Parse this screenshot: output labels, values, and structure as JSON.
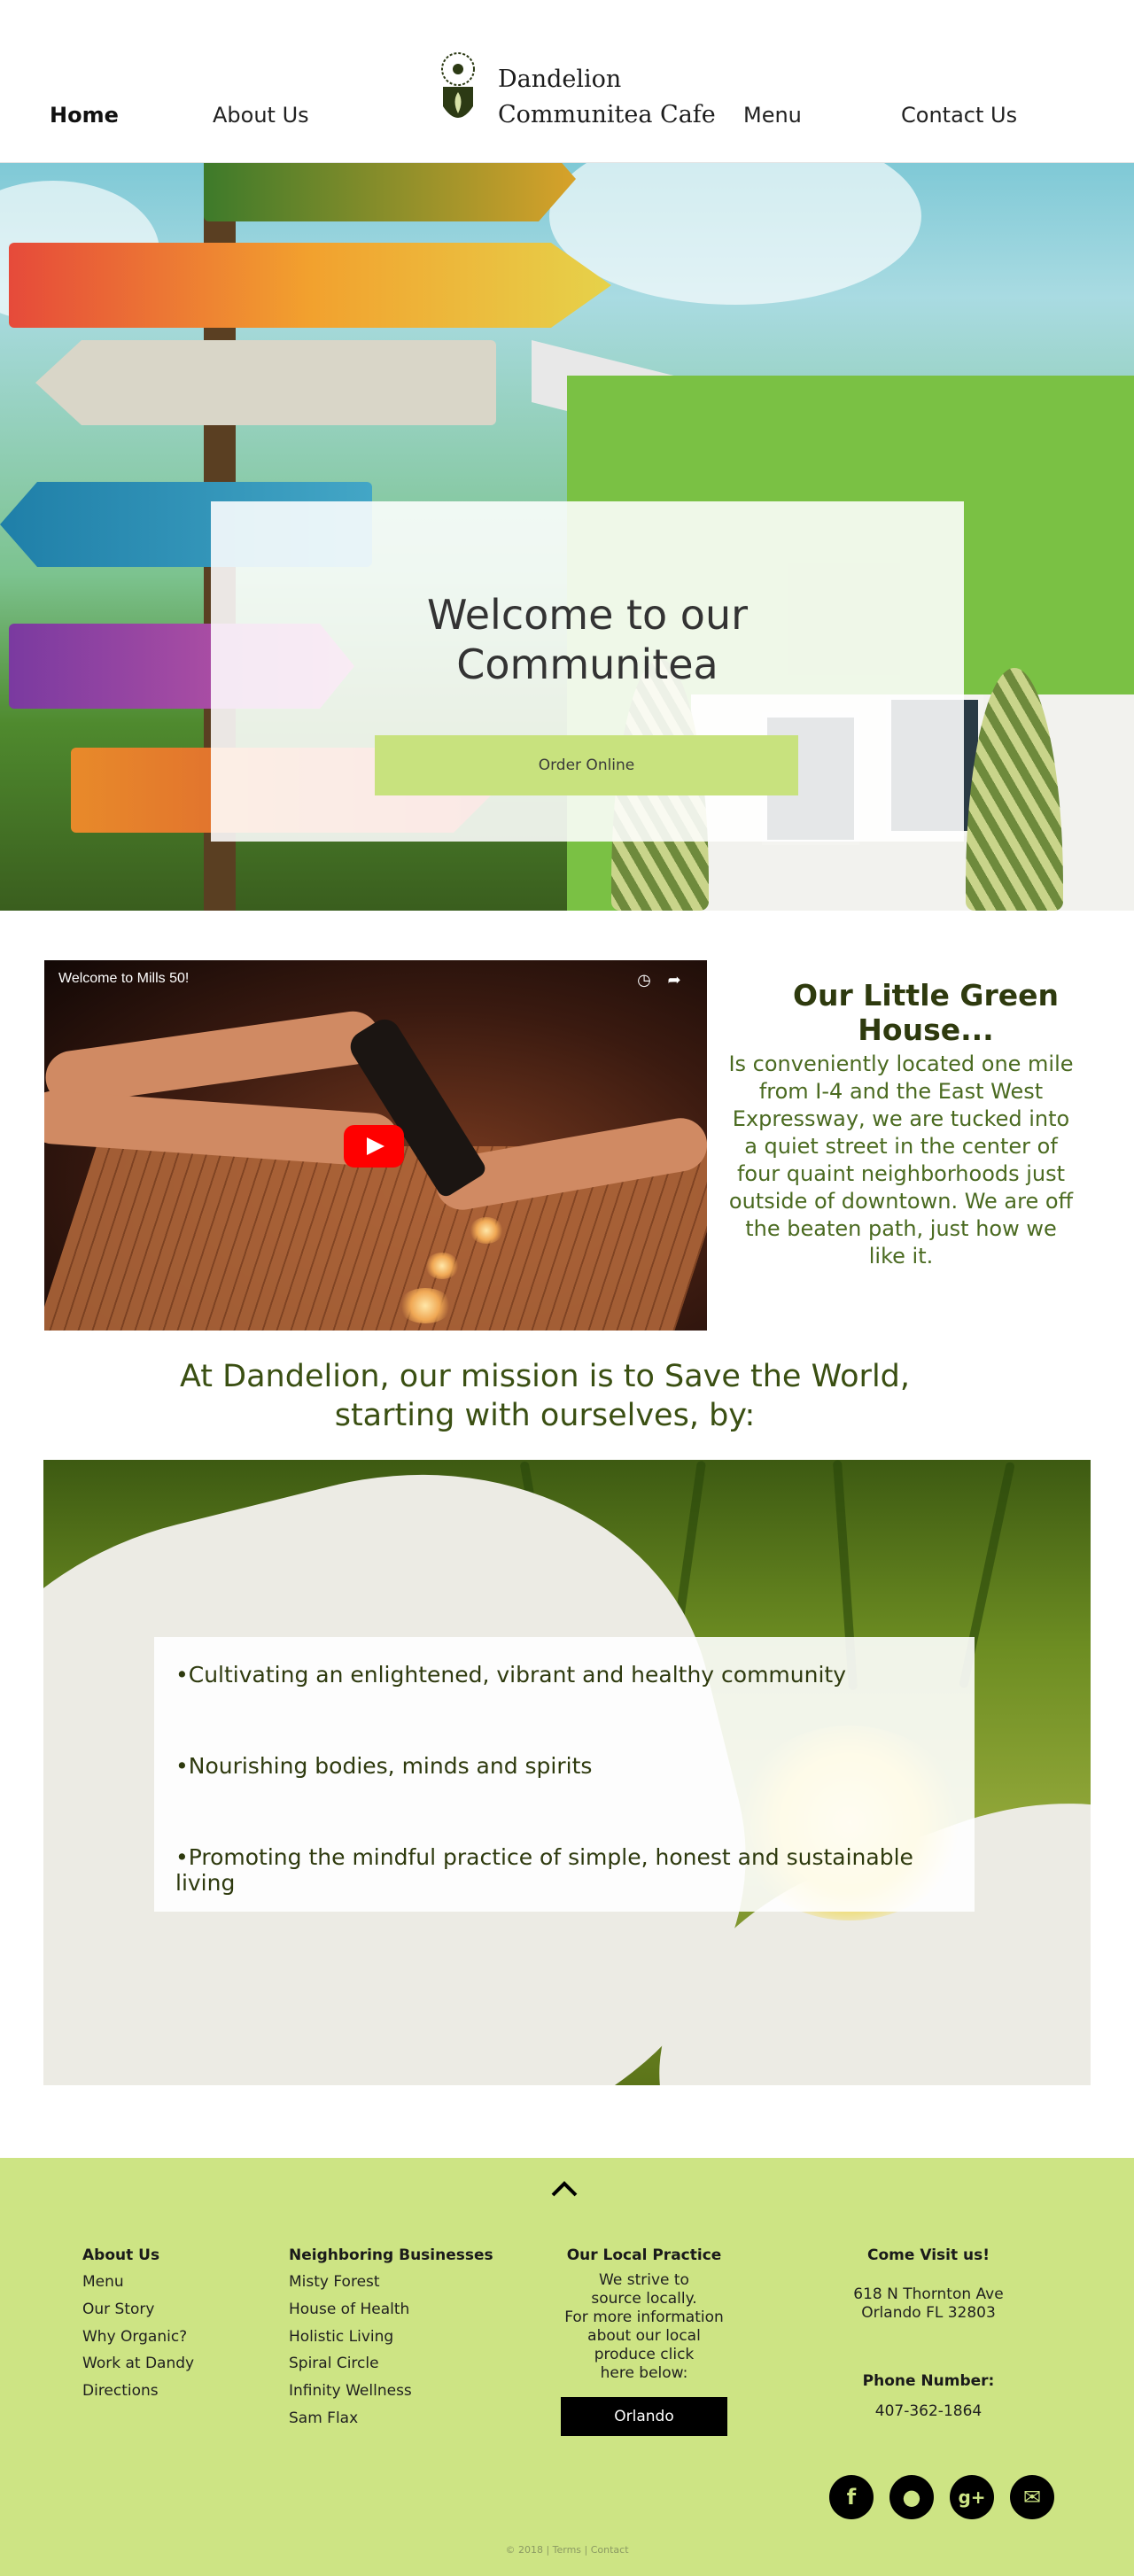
{
  "nav": {
    "home": "Home",
    "about": "About Us",
    "menu": "Menu",
    "contact": "Contact Us"
  },
  "brand": {
    "line1": "Dandelion",
    "line2": "Communitea Cafe"
  },
  "hero": {
    "title_line1": "Welcome to our",
    "title_line2": "Communitea",
    "order_button": "Order Online"
  },
  "video": {
    "title": "Welcome to Mills 50!"
  },
  "info": {
    "title": "Our Little Green House...",
    "body": "Is conveniently located one mile from I-4 and the East West Expressway, we are tucked into a quiet street in the center of four quaint neighborhoods just outside of downtown. We are off the beaten path, just how we like it."
  },
  "mission": {
    "line1": "At Dandelion, our mission is to Save the World,",
    "line2": "starting with ourselves, by:",
    "items": [
      "•Cultivating an enlightened, vibrant and healthy community",
      "•Nourishing bodies, minds and spirits",
      "•Promoting the mindful practice of simple, honest and sustainable living"
    ]
  },
  "footer": {
    "col1": {
      "title": "About Us",
      "links": [
        "Menu",
        "Our Story",
        "Why Organic?",
        "Work at Dandy",
        "Directions"
      ]
    },
    "col2": {
      "title": "Neighboring Businesses",
      "links": [
        "Misty Forest",
        "House of Health",
        "Holistic Living",
        "Spiral Circle",
        "Infinity Wellness",
        "Sam Flax"
      ]
    },
    "col3": {
      "title": "Our Local Practice",
      "lines": [
        "We strive to",
        "source locally.",
        "For more information",
        "about our local",
        "produce click",
        "here below:"
      ],
      "button": "Orlando"
    },
    "col4": {
      "title": "Come Visit us!",
      "address1": "618 N Thornton Ave",
      "address2": "Orlando FL 32803",
      "phone_label": "Phone Number:",
      "phone": "407-362-1864"
    },
    "social": [
      "facebook-icon",
      "twitter-icon",
      "google-plus-icon",
      "email-icon"
    ],
    "copyright": "© 2018 | Terms | Contact"
  },
  "colors": {
    "accent_green": "#cde484",
    "button_green": "#c8e27e",
    "dark_olive": "#2e3a0e"
  }
}
